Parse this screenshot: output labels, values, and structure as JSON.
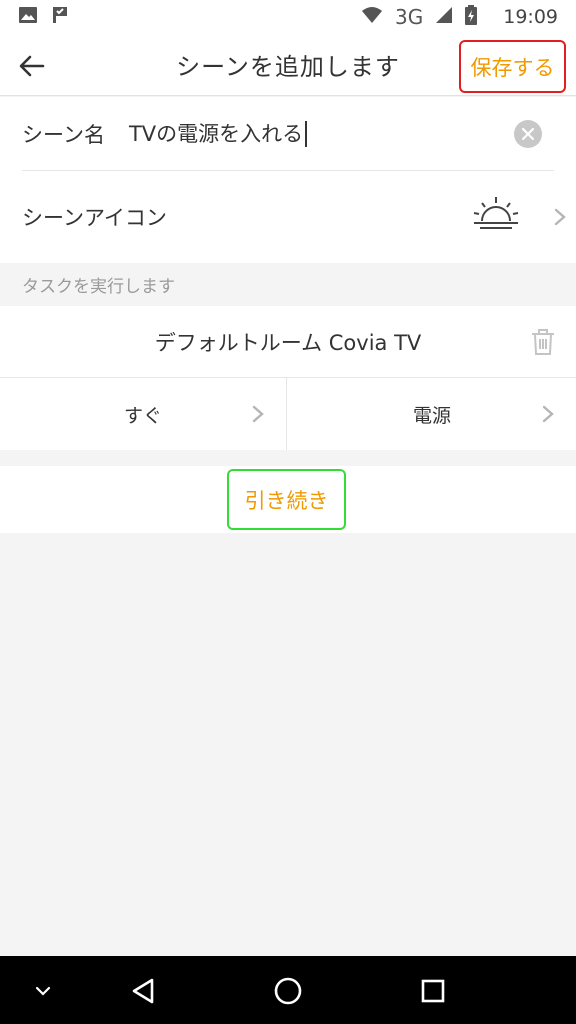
{
  "status_bar": {
    "network": "3G",
    "time": "19:09",
    "left_icons": [
      "image-icon",
      "check-flag-icon"
    ],
    "right_icons": [
      "wifi-icon",
      "signal-icon",
      "battery-icon"
    ]
  },
  "header": {
    "title": "シーンを追加します",
    "save_label": "保存する",
    "back_icon": "back-arrow-icon"
  },
  "form": {
    "name_label": "シーン名",
    "name_value": "TVの電源を入れる",
    "icon_label": "シーンアイコン",
    "icon_name": "sunrise-icon"
  },
  "section": {
    "label": "タスクを実行します"
  },
  "task": {
    "title": "デフォルトルーム Covia TV",
    "condition": "すぐ",
    "action": "電源"
  },
  "continue_label": "引き続き",
  "colors": {
    "accent": "#f09a00",
    "save_outline": "#e02020",
    "continue_outline": "#33dd33"
  }
}
